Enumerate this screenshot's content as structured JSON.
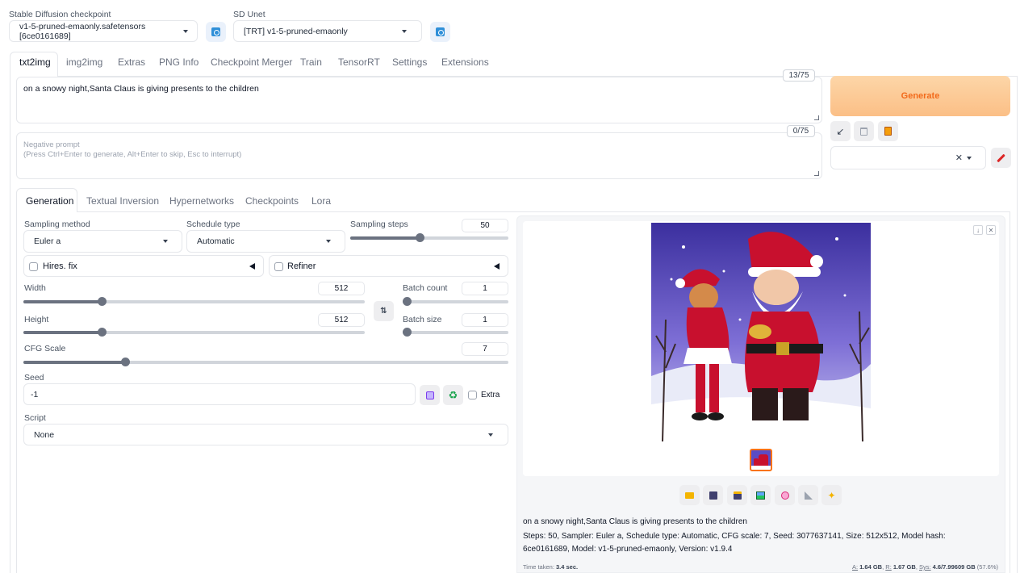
{
  "colors": {
    "accent": "#f97316",
    "generate_bg": "#fbc896",
    "generate_text": "#f26a1b"
  },
  "top": {
    "checkpoint_label": "Stable Diffusion checkpoint",
    "checkpoint_value": "v1-5-pruned-emaonly.safetensors [6ce0161689]",
    "unet_label": "SD Unet",
    "unet_value": "[TRT] v1-5-pruned-emaonly"
  },
  "tabs": [
    "txt2img",
    "img2img",
    "Extras",
    "PNG Info",
    "Checkpoint Merger",
    "Train",
    "TensorRT",
    "Settings",
    "Extensions"
  ],
  "prompt": {
    "value": "on a snowy night,Santa Claus is giving presents to the children",
    "counter": "13/75"
  },
  "negative": {
    "placeholder_line1": "Negative prompt",
    "placeholder_line2": "(Press Ctrl+Enter to generate, Alt+Enter to skip, Esc to interrupt)",
    "counter": "0/75"
  },
  "generate_label": "Generate",
  "subtabs": [
    "Generation",
    "Textual Inversion",
    "Hypernetworks",
    "Checkpoints",
    "Lora"
  ],
  "gen": {
    "sampling_method_label": "Sampling method",
    "sampling_method_value": "Euler a",
    "schedule_type_label": "Schedule type",
    "schedule_type_value": "Automatic",
    "sampling_steps_label": "Sampling steps",
    "sampling_steps_value": "50",
    "sampling_steps_fraction": 0.44,
    "hires_label": "Hires. fix",
    "refiner_label": "Refiner",
    "width_label": "Width",
    "width_value": "512",
    "width_fraction": 0.23,
    "height_label": "Height",
    "height_value": "512",
    "height_fraction": 0.23,
    "batch_count_label": "Batch count",
    "batch_count_value": "1",
    "batch_size_label": "Batch size",
    "batch_size_value": "1",
    "cfg_label": "CFG Scale",
    "cfg_value": "7",
    "cfg_fraction": 0.21,
    "seed_label": "Seed",
    "seed_value": "-1",
    "extra_label": "Extra",
    "script_label": "Script",
    "script_value": "None"
  },
  "output": {
    "info_prompt": "on a snowy night,Santa Claus is giving presents to the children",
    "info_params": "Steps: 50, Sampler: Euler a, Schedule type: Automatic, CFG scale: 7, Seed: 3077637141, Size: 512x512, Model hash: 6ce0161689, Model: v1-5-pruned-emaonly, Version: v1.9.4",
    "time_label": "Time taken:",
    "time_value": "3.4 sec.",
    "mem_a_label": "A:",
    "mem_a_value": "1.64 GB",
    "mem_r_label": "R:",
    "mem_r_value": "1.67 GB",
    "mem_sys_label": "Sys:",
    "mem_sys_value": "4.6/7.99609 GB",
    "mem_pct": "(57.6%)"
  }
}
